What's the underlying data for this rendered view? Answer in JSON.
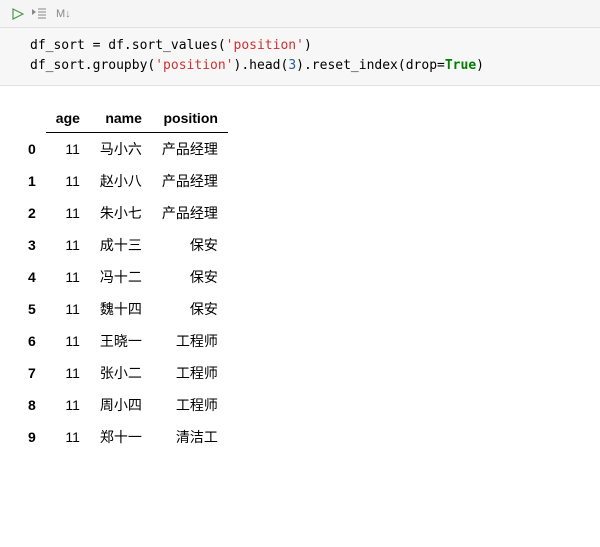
{
  "toolbar": {
    "markdown_label": "M↓"
  },
  "code": {
    "line1_pre": "df_sort = df.sort_values(",
    "line1_str": "'position'",
    "line1_post": ")",
    "line2_pre": "df_sort.groupby(",
    "line2_str1": "'position'",
    "line2_mid": ").head(",
    "line2_num": "3",
    "line2_mid2": ").reset_index(drop=",
    "line2_bool": "True",
    "line2_post": ")"
  },
  "table": {
    "columns": [
      "age",
      "name",
      "position"
    ],
    "rows": [
      {
        "idx": "0",
        "age": "11",
        "name": "马小六",
        "position": "产品经理"
      },
      {
        "idx": "1",
        "age": "11",
        "name": "赵小八",
        "position": "产品经理"
      },
      {
        "idx": "2",
        "age": "11",
        "name": "朱小七",
        "position": "产品经理"
      },
      {
        "idx": "3",
        "age": "11",
        "name": "成十三",
        "position": "保安"
      },
      {
        "idx": "4",
        "age": "11",
        "name": "冯十二",
        "position": "保安"
      },
      {
        "idx": "5",
        "age": "11",
        "name": "魏十四",
        "position": "保安"
      },
      {
        "idx": "6",
        "age": "11",
        "name": "王晓一",
        "position": "工程师"
      },
      {
        "idx": "7",
        "age": "11",
        "name": "张小二",
        "position": "工程师"
      },
      {
        "idx": "8",
        "age": "11",
        "name": "周小四",
        "position": "工程师"
      },
      {
        "idx": "9",
        "age": "11",
        "name": "郑十一",
        "position": "清洁工"
      }
    ]
  }
}
